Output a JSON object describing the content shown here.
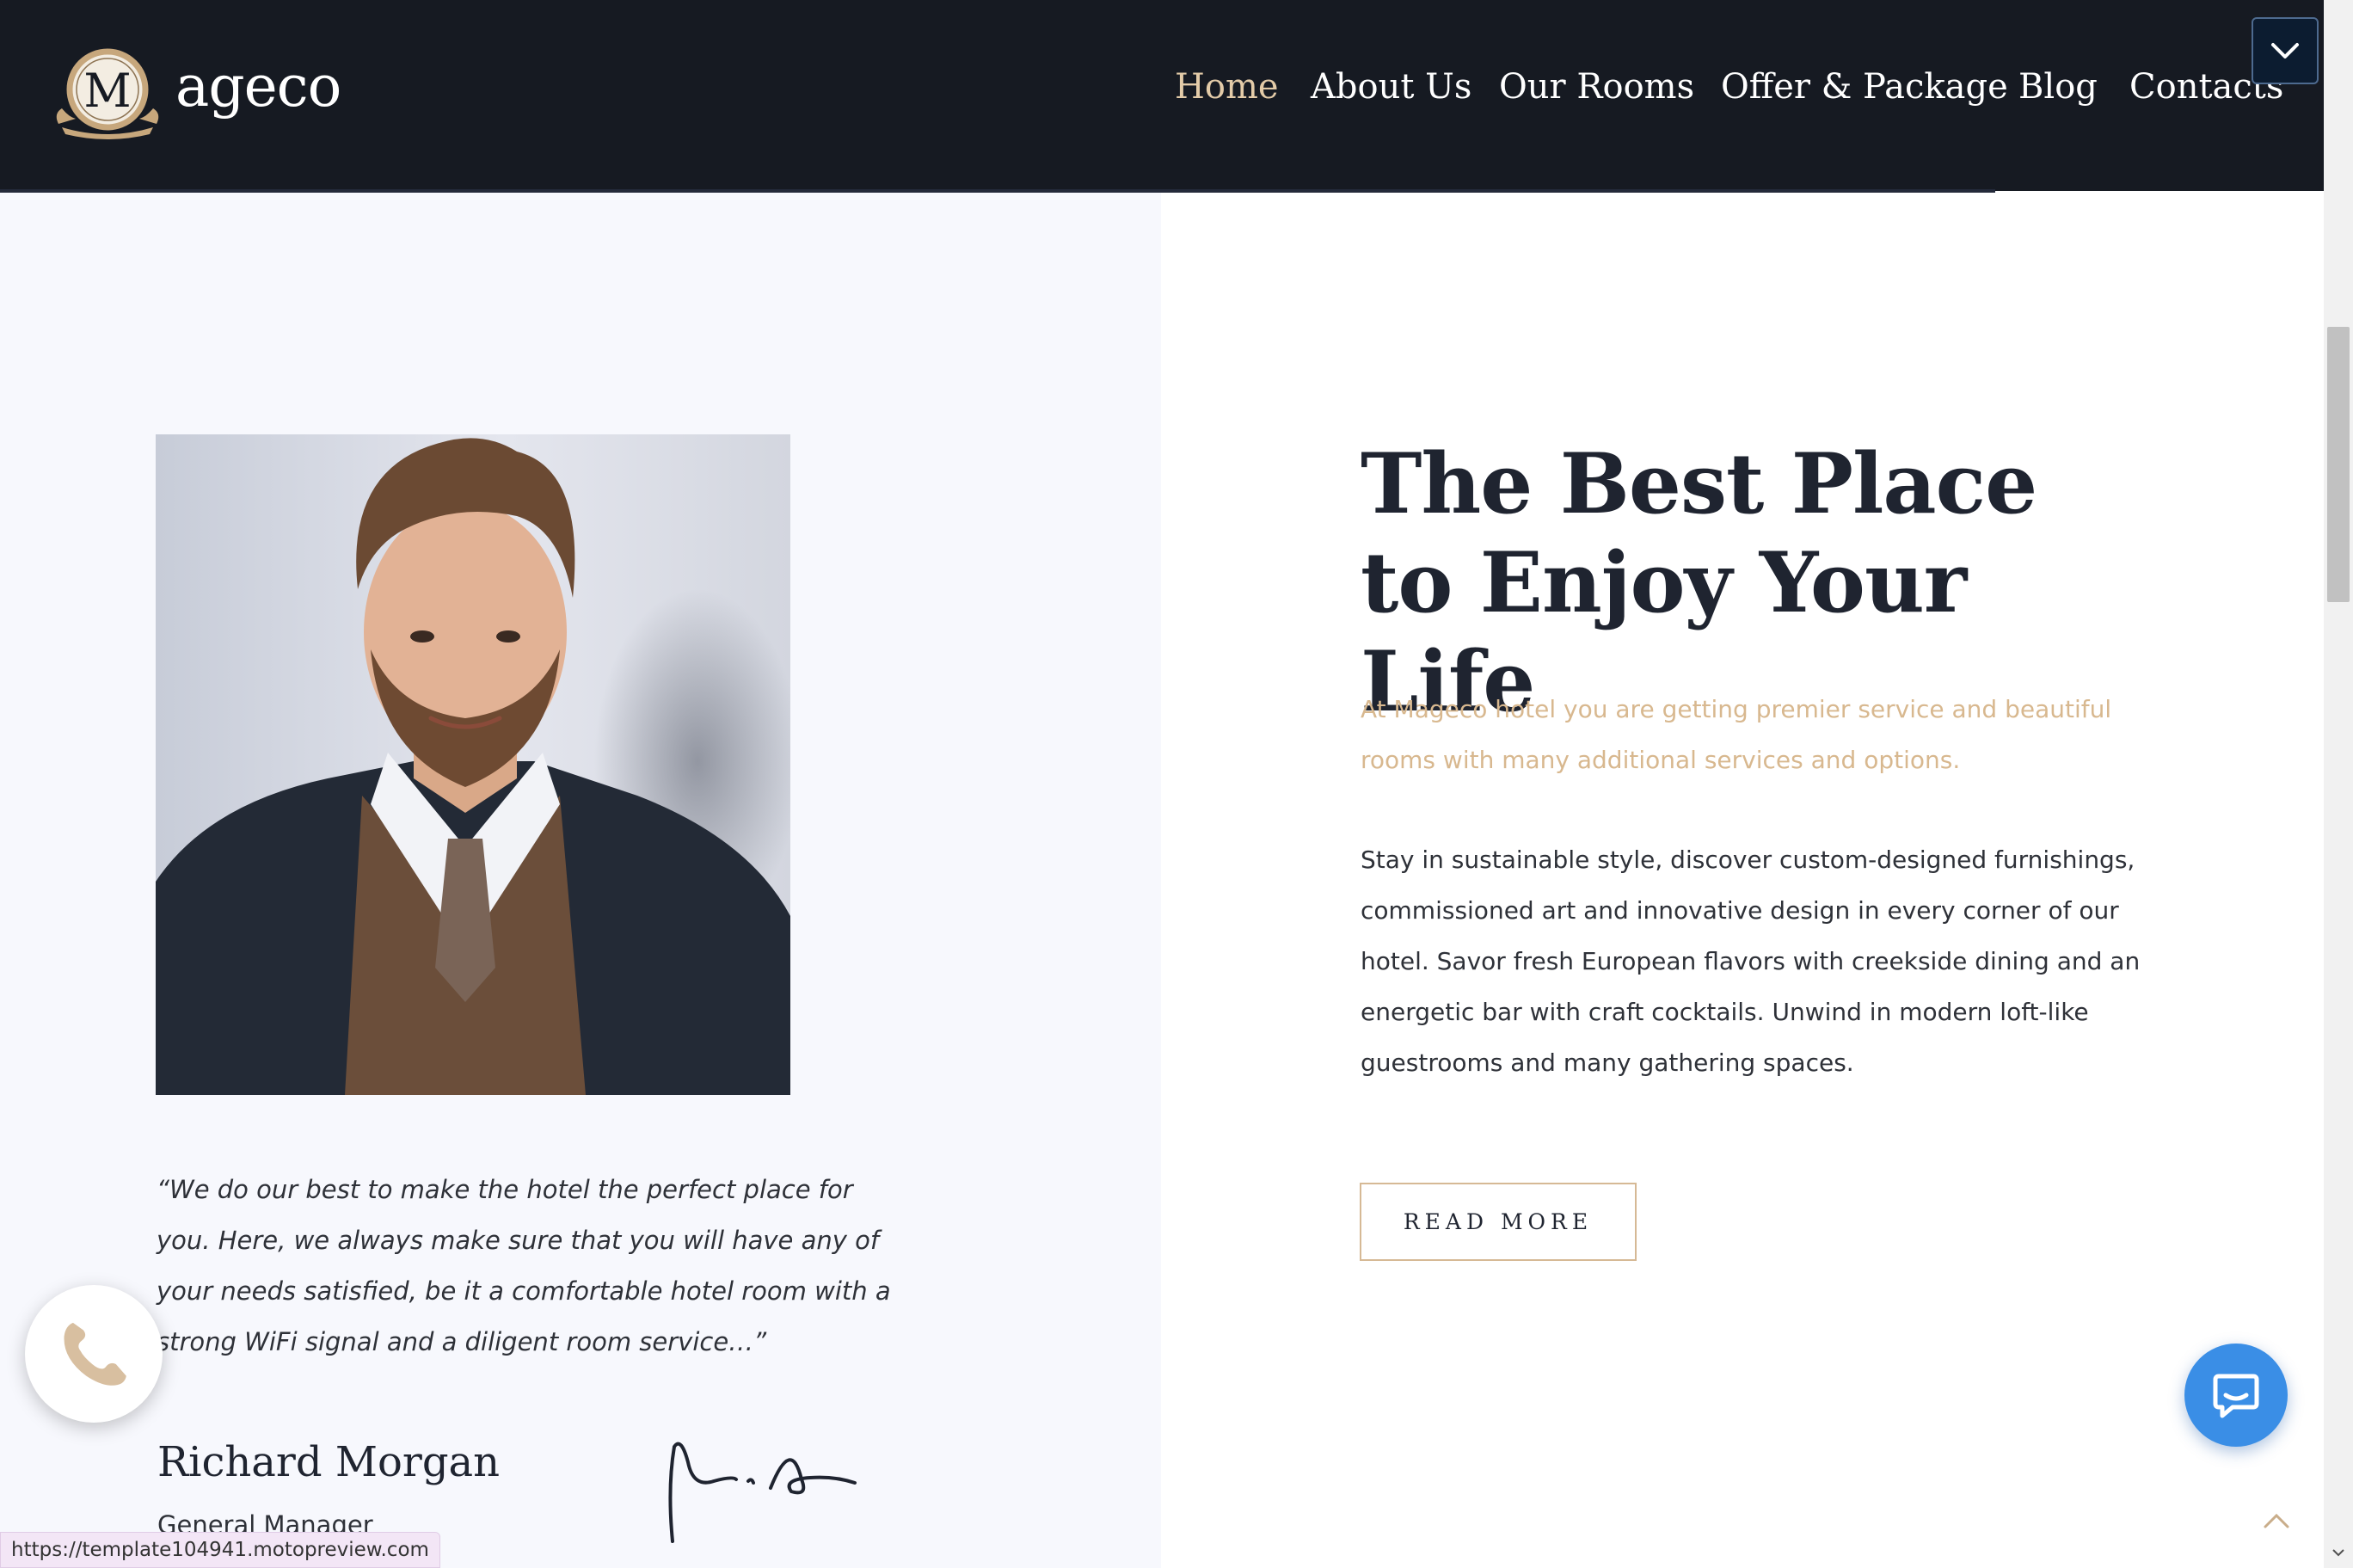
{
  "header": {
    "logo_letter": "M",
    "brand_name": "ageco",
    "nav": [
      {
        "label": "Home",
        "active": true
      },
      {
        "label": "About Us",
        "active": false
      },
      {
        "label": "Our Rooms",
        "active": false
      },
      {
        "label": "Offer & Package",
        "active": false
      },
      {
        "label": "Blog",
        "active": false
      },
      {
        "label": "Contacts",
        "active": false
      }
    ],
    "menu_toggle_icon": "chevron-down-icon"
  },
  "about": {
    "quote": "“We do our best to make the hotel the perfect place for you. Here, we always make sure that you will have any of your needs satisfied, be it a comfortable hotel room with a strong WiFi signal and a diligent room service…”",
    "manager_name": "Richard Morgan",
    "manager_title": "General Manager",
    "headline": "The Best Place to Enjoy Your Life",
    "lead": "At Mageco hotel you are getting premier service and beautiful rooms with many additional services and options.",
    "body": "Stay in sustainable style, discover custom-designed furnishings, commissioned art and innovative design in every corner of our hotel. Savor fresh European flavors with creekside dining and an energetic bar with craft cocktails. Unwind in modern loft-like guestrooms and many gathering spaces.",
    "read_more_label": "READ MORE"
  },
  "status_bar": {
    "url": "https://template104941.motopreview.com"
  },
  "colors": {
    "header_bg": "#161a22",
    "nav_active": "#e3cba8",
    "accent_gold": "#d8b88f",
    "left_panel_bg": "#f7f8fd",
    "chat_blue": "#3a8ee6"
  }
}
